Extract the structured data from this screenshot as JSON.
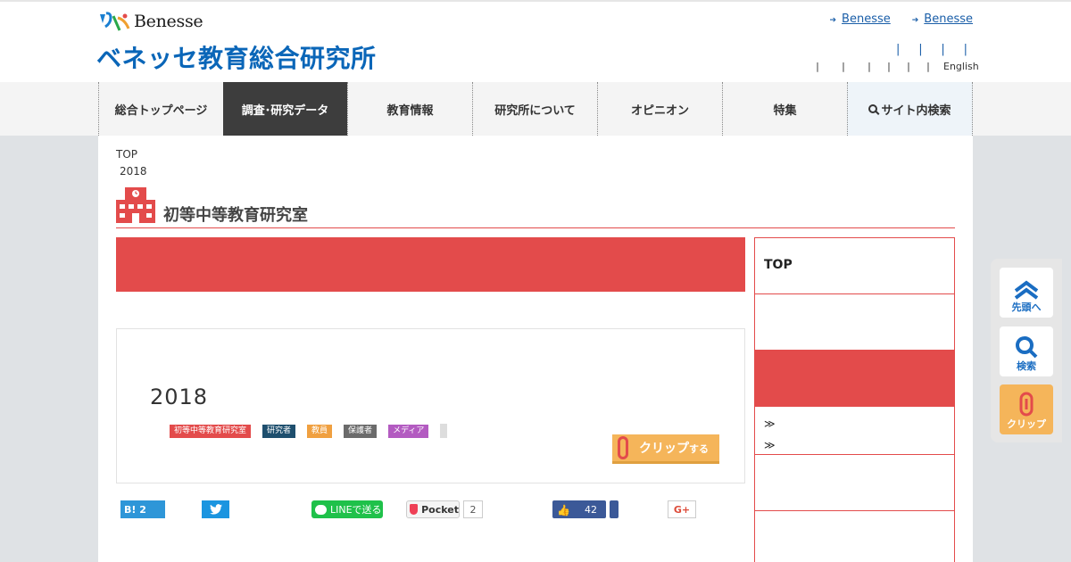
{
  "header": {
    "logo_word": "Benesse",
    "site_title": "ベネッセ教育総合研究所",
    "top_links": [
      "Benesse",
      "Benesse"
    ],
    "utility_seps_row1": [
      "|",
      "|",
      "|",
      "|"
    ],
    "utility_seps_row2": [
      "|",
      "|",
      "|",
      "|",
      "|",
      "|"
    ],
    "english_label": "English"
  },
  "nav": {
    "items": [
      {
        "label": "総合トップページ"
      },
      {
        "label": "調査･研究データ"
      },
      {
        "label": "教育情報"
      },
      {
        "label": "研究所について"
      },
      {
        "label": "オピニオン"
      },
      {
        "label": "特集"
      },
      {
        "label": "サイト内検索"
      }
    ]
  },
  "breadcrumb": {
    "root": "TOP",
    "current": "2018"
  },
  "section": {
    "title": "初等中等教育研究室"
  },
  "article": {
    "year": "2018",
    "tags": [
      {
        "label": "初等中等教育研究室",
        "color": "#e34b4b"
      },
      {
        "label": "研究者",
        "color": "#1e4f6e"
      },
      {
        "label": "教員",
        "color": "#f0a040"
      },
      {
        "label": "保護者",
        "color": "#6b6b6b"
      },
      {
        "label": "メディア",
        "color": "#b35bc1"
      }
    ],
    "clip_label": "クリップ",
    "clip_suffix": "する"
  },
  "share": {
    "hatena": "B! 2",
    "line": "LINEで送る",
    "pocket": "Pocket",
    "pocket_count": "2",
    "fb_count": "42",
    "gplus": "G+"
  },
  "sidebar": {
    "top": "TOP",
    "link_marks": [
      "≫",
      "≫"
    ]
  },
  "float_tools": {
    "top": "先頭へ",
    "search": "検索",
    "clip": "クリップ"
  },
  "colors": {
    "accent_red": "#e34b4b",
    "brand_blue": "#0a66b8",
    "nav_active": "#3d3d3d",
    "clip_orange": "#f5b55a"
  }
}
